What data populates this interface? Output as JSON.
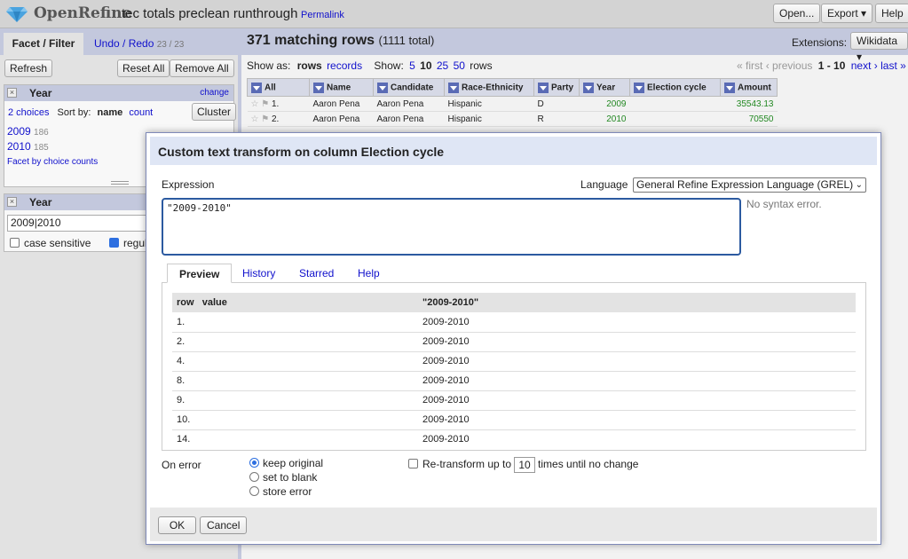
{
  "header": {
    "app_name": "OpenRefine",
    "project_name": "tec totals preclean runthrough",
    "permalink": "Permalink",
    "buttons": {
      "open": "Open...",
      "export": "Export ▾",
      "help": "Help"
    }
  },
  "left": {
    "tab_facet": "Facet / Filter",
    "tab_undo": "Undo / Redo",
    "undo_count": "23 / 23",
    "refresh": "Refresh",
    "reset_all": "Reset All",
    "remove_all": "Remove All",
    "facet1": {
      "title": "Year",
      "change": "change",
      "choices": "2 choices",
      "sort_by": "Sort by:",
      "sort_name": "name",
      "sort_count": "count",
      "cluster": "Cluster",
      "items": [
        {
          "label": "2009",
          "count": "186"
        },
        {
          "label": "2010",
          "count": "185"
        }
      ],
      "facet_by_counts": "Facet by choice counts"
    },
    "facet2": {
      "title": "Year",
      "value": "2009|2010",
      "case_sensitive": "case sensitive",
      "regular": "regul"
    }
  },
  "right": {
    "matching": "371 matching rows",
    "total": "(1111 total)",
    "extensions_label": "Extensions:",
    "extensions_btn": "Wikidata ▾",
    "show_as": "Show as:",
    "rows": "rows",
    "records": "records",
    "show": "Show:",
    "page_sizes": [
      "5",
      "10",
      "25",
      "50"
    ],
    "rows_suffix": "rows",
    "pager": {
      "first": "« first",
      "previous": "‹ previous",
      "range": "1 - 10",
      "next": "next ›",
      "last": "last »"
    },
    "columns": [
      "All",
      "Name",
      "Candidate",
      "Race-Ethnicity",
      "Party",
      "Year",
      "Election cycle",
      "Amount"
    ],
    "rows_data": [
      {
        "n": "1.",
        "name": "Aaron Pena",
        "candidate": "Aaron Pena",
        "race": "Hispanic",
        "party": "D",
        "year": "2009",
        "cycle": "",
        "amount": "35543.13"
      },
      {
        "n": "2.",
        "name": "Aaron Pena",
        "candidate": "Aaron Pena",
        "race": "Hispanic",
        "party": "R",
        "year": "2010",
        "cycle": "",
        "amount": "70550"
      }
    ]
  },
  "dialog": {
    "title": "Custom text transform on column Election cycle",
    "expression_label": "Expression",
    "language_label": "Language",
    "language_value": "General Refine Expression Language (GREL)",
    "expression": "\"2009-2010\"",
    "syntax_status": "No syntax error.",
    "tabs": [
      "Preview",
      "History",
      "Starred",
      "Help"
    ],
    "preview_headers": {
      "row": "row",
      "value": "value",
      "result": "\"2009-2010\""
    },
    "preview_rows": [
      {
        "row": "1.",
        "result": "2009-2010"
      },
      {
        "row": "2.",
        "result": "2009-2010"
      },
      {
        "row": "4.",
        "result": "2009-2010"
      },
      {
        "row": "8.",
        "result": "2009-2010"
      },
      {
        "row": "9.",
        "result": "2009-2010"
      },
      {
        "row": "10.",
        "result": "2009-2010"
      },
      {
        "row": "14.",
        "result": "2009-2010"
      }
    ],
    "on_error_label": "On error",
    "on_error_options": [
      "keep original",
      "set to blank",
      "store error"
    ],
    "retransform_prefix": "Re-transform up to",
    "retransform_count": "10",
    "retransform_suffix": "times until no change",
    "ok": "OK",
    "cancel": "Cancel"
  },
  "colors": {
    "accent": "#c3c8dd",
    "link": "#1111cc",
    "focus": "#2c5aa0"
  }
}
